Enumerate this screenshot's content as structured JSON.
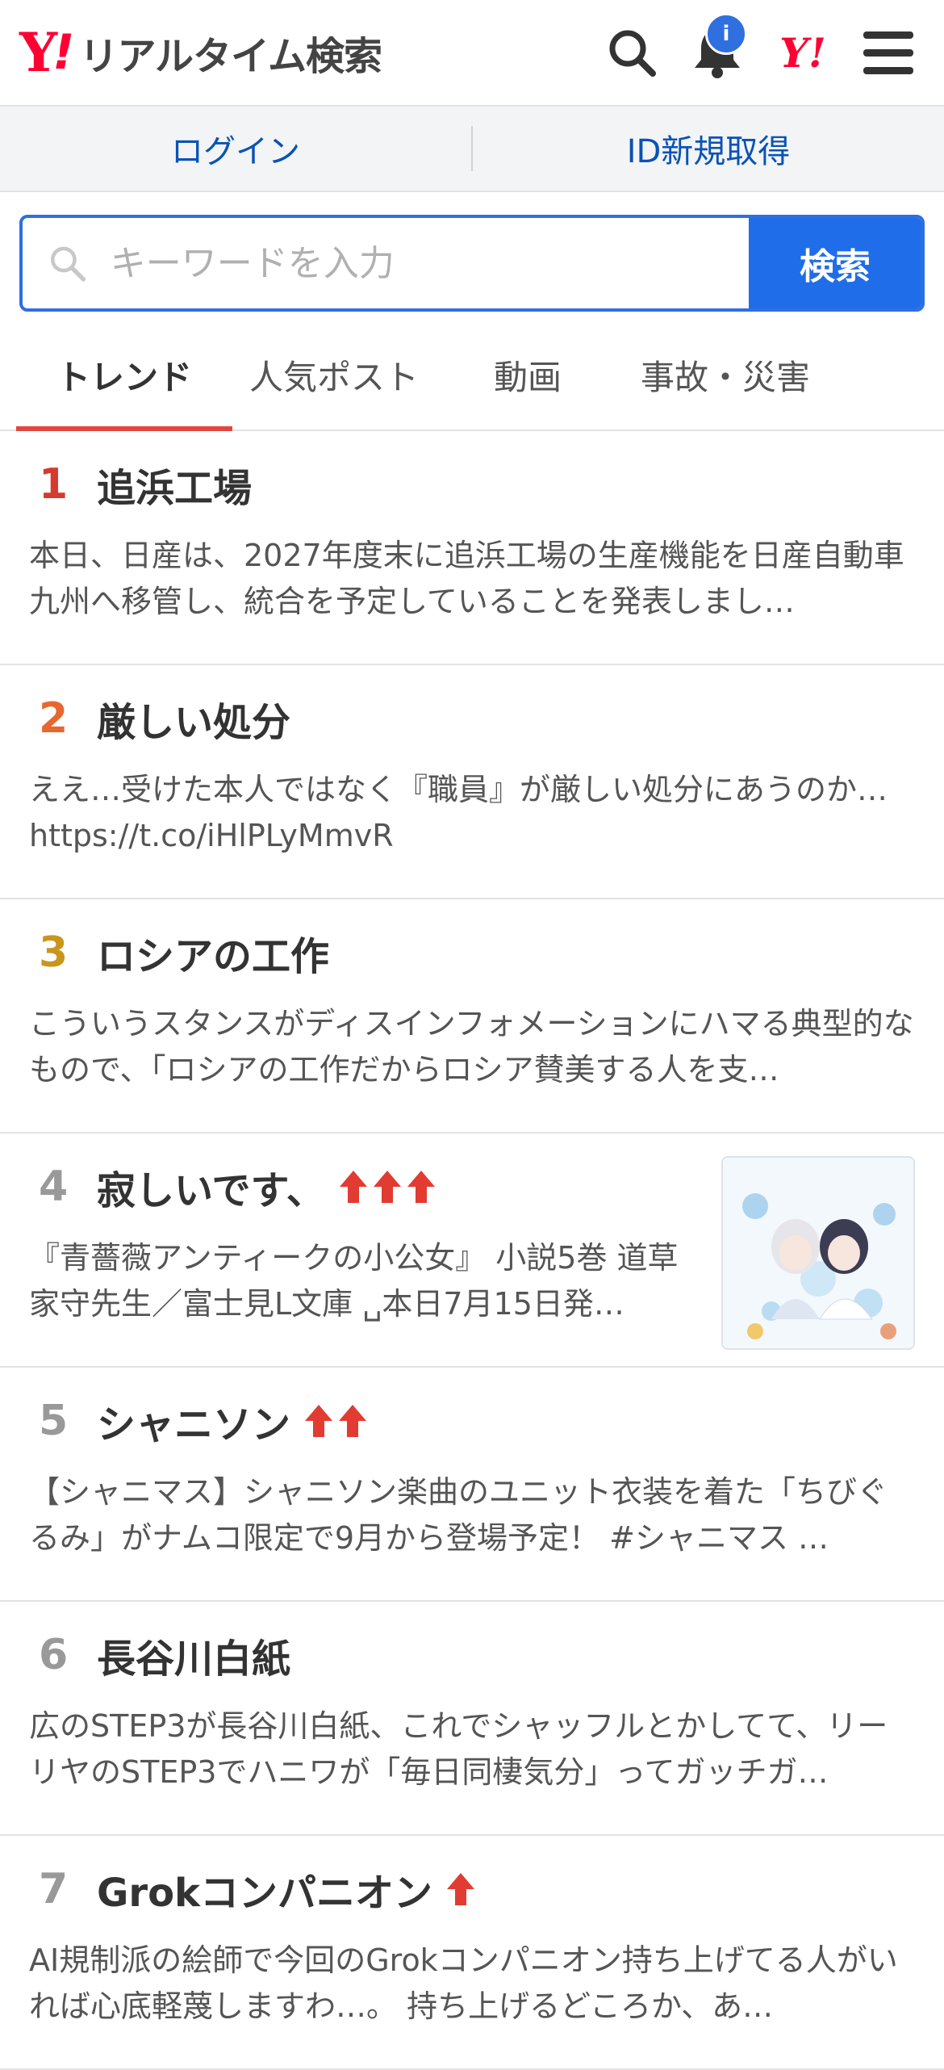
{
  "header": {
    "logo_y": "Y",
    "logo_ex": "!",
    "logo_title": "リアルタイム検索",
    "notification_badge": "i",
    "yahoo_mark": "Y!"
  },
  "auth": {
    "login": "ログイン",
    "register": "ID新規取得"
  },
  "search": {
    "placeholder": "キーワードを入力",
    "button": "検索"
  },
  "tabs": [
    {
      "label": "トレンド"
    },
    {
      "label": "人気ポスト"
    },
    {
      "label": "動画"
    },
    {
      "label": "事故・災害"
    }
  ],
  "rank_colors": [
    "#d63a2e",
    "#e8672f",
    "#c8961c",
    "#999999",
    "#999999",
    "#999999",
    "#999999"
  ],
  "items": [
    {
      "rank": "1",
      "keyword": "追浜工場",
      "description": "本日、日産は、2027年度末に追浜工場の生産機能を日産自動車九州へ移管し、統合を予定していることを発表しまし…",
      "arrows": 0
    },
    {
      "rank": "2",
      "keyword": "厳しい処分",
      "description": "ええ…受けた本人ではなく『職員』が厳しい処分にあうのか… https://t.co/iHlPLyMmvR",
      "arrows": 0
    },
    {
      "rank": "3",
      "keyword": "ロシアの工作",
      "description": "こういうスタンスがディスインフォメーションにハマる典型的なもので、「ロシアの工作だからロシア賛美する人を支…",
      "arrows": 0
    },
    {
      "rank": "4",
      "keyword": "寂しいです、",
      "description": "『青薔薇アンティークの小公女』 小説5巻 道草家守先生／富士見L文庫 ␣本日7月15日発…",
      "arrows": 3
    },
    {
      "rank": "5",
      "keyword": "シャニソン",
      "description": "【シャニマス】シャニソン楽曲のユニット衣装を着た「ちびぐるみ」がナムコ限定で9月から登場予定！ #シャニマス …",
      "arrows": 2
    },
    {
      "rank": "6",
      "keyword": "長谷川白紙",
      "description": "広のSTEP3が長谷川白紙、これでシャッフルとかしてて、リーリヤのSTEP3でハニワが「毎日同棲気分」ってガッチガ…",
      "arrows": 0
    },
    {
      "rank": "7",
      "keyword": "Grokコンパニオン",
      "description": "AI規制派の絵師で今回のGrokコンパニオン持ち上げてる人がいれば心底軽蔑しますわ…。 持ち上げるどころか、あ…",
      "arrows": 1
    }
  ]
}
